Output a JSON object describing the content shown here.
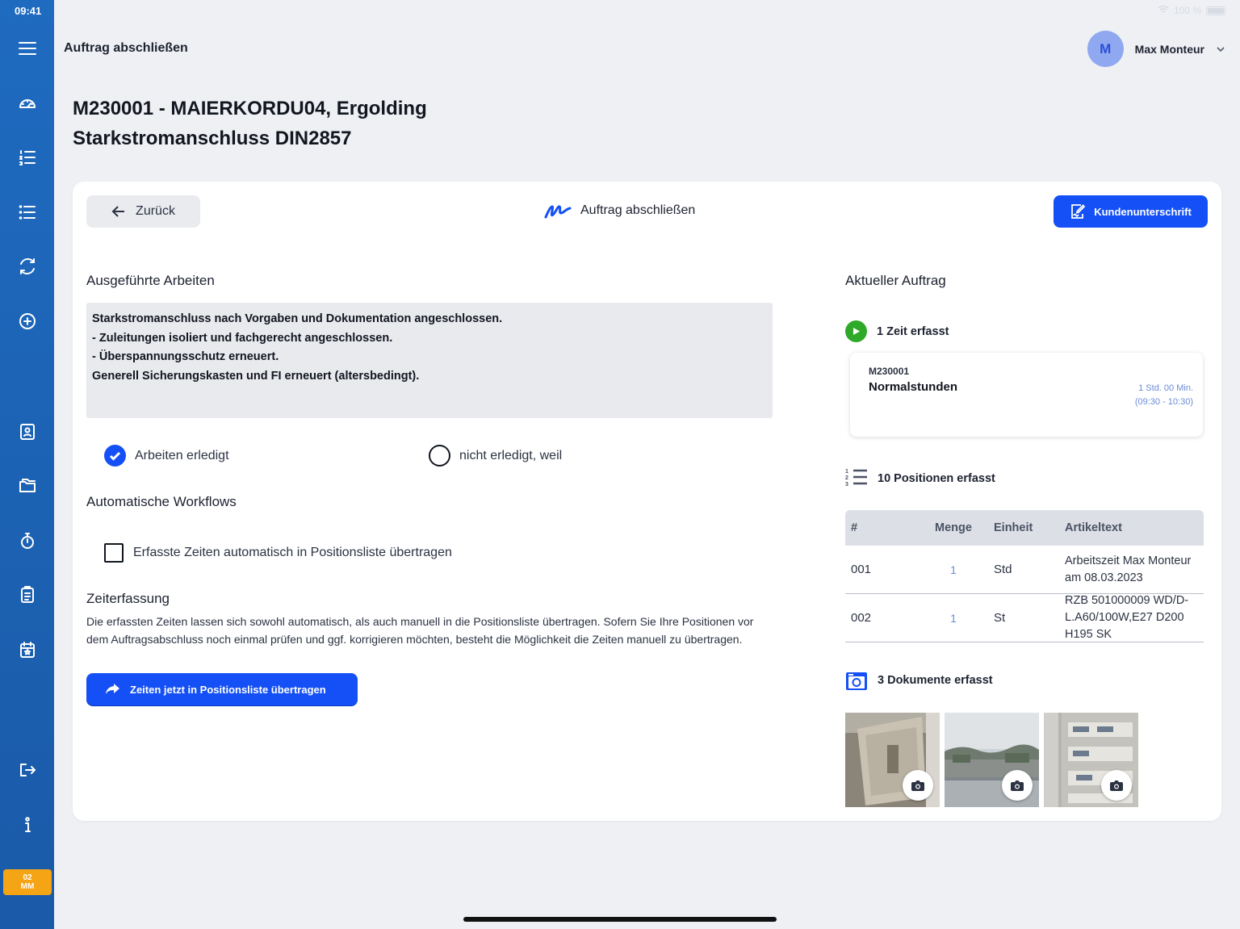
{
  "status_bar": {
    "time": "09:41",
    "battery": "100 %"
  },
  "header": {
    "title": "Auftrag abschließen"
  },
  "user": {
    "initial": "M",
    "name": "Max Monteur"
  },
  "page": {
    "title_line1": "M230001 - MAIERKORDU04, Ergolding",
    "title_line2": "Starkstromanschluss DIN2857"
  },
  "sidebar": {
    "items": [
      {
        "icon": "menu-icon"
      },
      {
        "icon": "dashboard-icon"
      },
      {
        "icon": "numbered-list-icon"
      },
      {
        "icon": "list-icon"
      },
      {
        "icon": "sync-icon"
      },
      {
        "icon": "add-circle-icon"
      },
      {
        "icon": "contacts-icon"
      },
      {
        "icon": "folder-icon"
      },
      {
        "icon": "stopwatch-icon"
      },
      {
        "icon": "clipboard-icon"
      },
      {
        "icon": "calendar-icon"
      },
      {
        "icon": "logout-icon"
      },
      {
        "icon": "info-icon"
      }
    ],
    "badge_line1": "02",
    "badge_line2": "MM"
  },
  "toolbar": {
    "back_label": "Zurück",
    "center_title": "Auftrag abschließen",
    "sign_label": "Kundenunterschrift"
  },
  "left": {
    "work_heading": "Ausgeführte Arbeiten",
    "work_text": "Starkstromanschluss nach Vorgaben und Dokumentation angeschlossen.\n- Zuleitungen isoliert und fachgerecht angeschlossen.\n- Überspannungsschutz erneuert.\nGenerell Sicherungskasten und FI erneuert (altersbedingt).",
    "radio_done": "Arbeiten erledigt",
    "radio_not_done": "nicht erledigt, weil",
    "workflow_heading": "Automatische Workflows",
    "workflow_check": "Erfasste Zeiten automatisch in Positionsliste übertragen",
    "time_heading": "Zeiterfassung",
    "time_desc": "Die erfassten Zeiten lassen sich sowohl automatisch, als auch manuell in die Positionsliste übertragen. Sofern Sie Ihre Positionen vor dem Auftragsabschluss noch einmal prüfen und ggf. korrigieren möchten, besteht die Möglichkeit die Zeiten manuell zu übertragen.",
    "transfer_label": "Zeiten jetzt in Positionsliste übertragen"
  },
  "right": {
    "heading": "Aktueller Auftrag",
    "times_label": "1 Zeit erfasst",
    "time_entry": {
      "code": "M230001",
      "name": "Normalstunden",
      "duration": "1 Std. 00 Min.",
      "range": "(09:30 - 10:30)"
    },
    "positions_label": "10 Positionen erfasst",
    "table": {
      "headers": [
        "#",
        "Menge",
        "Einheit",
        "Artikeltext"
      ],
      "rows": [
        {
          "num": "001",
          "qty": "1",
          "unit": "Std",
          "text": "Arbeitszeit Max Monteur am 08.03.2023"
        },
        {
          "num": "002",
          "qty": "1",
          "unit": "St",
          "text": "RZB 501000009 WD/D-L.A60/100W,E27 D200 H195 SK"
        }
      ]
    },
    "documents_label": "3 Dokumente erfasst"
  }
}
